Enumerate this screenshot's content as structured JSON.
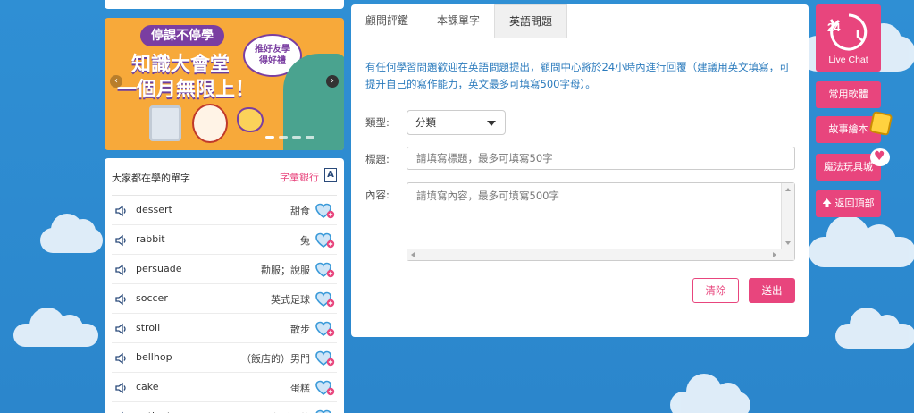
{
  "banner": {
    "pill": "停課不停學",
    "headline1": "知識大會堂",
    "headline2": "一個月無限上！",
    "bubble_line1": "推好友學",
    "bubble_line2": "得好禮"
  },
  "vocab": {
    "title": "大家都在學的單字",
    "bank_label": "字彙銀行",
    "bank_icon": "A",
    "items": [
      {
        "word": "dessert",
        "meaning": "甜食"
      },
      {
        "word": "rabbit",
        "meaning": "兔"
      },
      {
        "word": "persuade",
        "meaning": "勸服；說服"
      },
      {
        "word": "soccer",
        "meaning": "英式足球"
      },
      {
        "word": "stroll",
        "meaning": "散步"
      },
      {
        "word": "bellhop",
        "meaning": "（飯店的）男門"
      },
      {
        "word": "cake",
        "meaning": "蛋糕"
      },
      {
        "word": "patient",
        "meaning": "有耐心的"
      }
    ]
  },
  "panel": {
    "tabs": [
      "顧問評鑑",
      "本課單字",
      "英語問題"
    ],
    "active_tab": 2,
    "intro": "有任何學習問題歡迎在英語問題提出，顧問中心將於24小時內進行回覆（建議用英文填寫，可提升自己的寫作能力，英文最多可填寫500字母）。",
    "type_label": "類型:",
    "type_value": "分類",
    "title_label": "標題:",
    "title_placeholder": "請填寫標題，最多可填寫50字",
    "content_label": "內容:",
    "content_placeholder": "請填寫內容，最多可填寫500字",
    "clear_label": "清除",
    "send_label": "送出"
  },
  "side": {
    "live_number": "24",
    "live_label": "Live Chat",
    "gift": "常用軟體",
    "story": "故事繪本",
    "toys": "魔法玩具城",
    "totop": "返回頂部"
  },
  "colors": {
    "accent": "#e8457d",
    "link_blue": "#2b7bbd",
    "sky": "#2f8fd4"
  }
}
